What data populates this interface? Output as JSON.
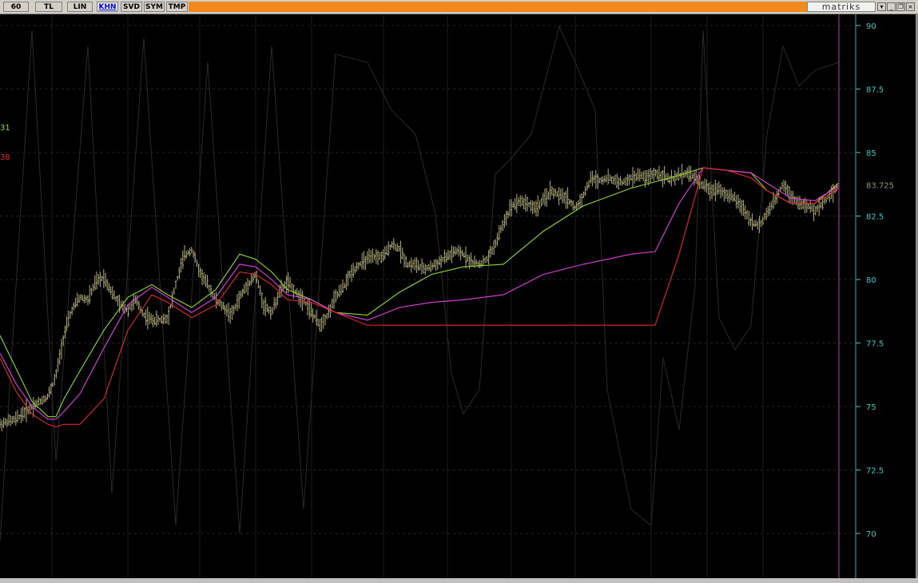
{
  "toolbar": {
    "buttons": [
      "60",
      "TL",
      "LIN",
      "KHN",
      "SVD",
      "SYM",
      "TMP"
    ],
    "active_button": "KHN",
    "brand": "matriks",
    "window_controls": [
      "dropdown-icon",
      "minimize-icon",
      "restore-icon",
      "close-icon"
    ]
  },
  "colors": {
    "background": "#000000",
    "candles": "#b3b07a",
    "ma_green": "#8ed82a",
    "ma_magenta": "#e040e0",
    "ma_red": "#e02828",
    "axis_text": "#3fc7c7",
    "cursor_line": "#c030c0",
    "price_label": "#9a9468"
  },
  "left_labels": [
    {
      "text": "31",
      "color": "#8ed82a"
    },
    {
      "text": "38",
      "color": "#e02828"
    }
  ],
  "chart_data": {
    "type": "line",
    "y_ticks": [
      "90",
      "87.5",
      "85",
      "82.5",
      "80",
      "77.5",
      "75",
      "72.5",
      "70"
    ],
    "ylim": [
      68.3,
      90.3
    ],
    "last_price": "83.725",
    "xlim": [
      0,
      1050
    ],
    "series": [
      {
        "role": "price",
        "x": [
          0,
          20,
          40,
          60,
          70,
          80,
          90,
          100,
          110,
          120,
          130,
          140,
          150,
          160,
          170,
          180,
          190,
          200,
          210,
          220,
          230,
          240,
          250,
          260,
          270,
          280,
          290,
          300,
          310,
          320,
          330,
          340,
          350,
          360,
          370,
          380,
          390,
          400,
          410,
          420,
          430,
          440,
          450,
          460,
          470,
          480,
          490,
          500,
          510,
          520,
          530,
          540,
          550,
          560,
          570,
          580,
          590,
          600,
          610,
          620,
          630,
          640,
          650,
          660,
          670,
          680,
          690,
          700,
          710,
          720,
          730,
          740,
          750,
          760,
          770,
          780,
          790,
          800,
          810,
          820,
          830,
          840,
          850,
          860,
          870,
          880,
          890,
          900,
          910,
          920,
          930,
          940,
          950,
          960,
          970,
          980,
          990,
          1000,
          1010,
          1020,
          1030,
          1040,
          1050
        ],
        "values": [
          74.3,
          74.5,
          75.0,
          75.4,
          76.2,
          77.8,
          78.8,
          79.3,
          79.2,
          79.9,
          80.1,
          79.5,
          79.0,
          78.8,
          79.2,
          78.6,
          78.4,
          78.4,
          78.5,
          79.8,
          80.9,
          81.2,
          80.3,
          79.8,
          79.2,
          78.9,
          78.6,
          79.3,
          79.8,
          80.2,
          79.0,
          78.7,
          79.5,
          79.9,
          79.5,
          79.2,
          78.7,
          78.2,
          78.6,
          79.3,
          79.7,
          80.3,
          80.6,
          80.8,
          80.9,
          80.9,
          81.4,
          81.2,
          80.6,
          80.6,
          80.4,
          80.5,
          80.7,
          80.9,
          81.1,
          81.0,
          80.7,
          80.6,
          80.8,
          81.4,
          82.2,
          82.9,
          83.1,
          83.0,
          82.8,
          83.1,
          83.5,
          83.3,
          83.2,
          82.8,
          83.3,
          84.0,
          83.9,
          84.0,
          83.9,
          83.8,
          84.0,
          84.1,
          84.0,
          84.2,
          84.1,
          83.9,
          84.1,
          84.2,
          84.0,
          83.7,
          83.5,
          83.6,
          83.3,
          83.2,
          82.8,
          82.3,
          82.1,
          82.6,
          83.1,
          83.8,
          83.3,
          83.0,
          82.9,
          82.7,
          83.0,
          83.4,
          83.725
        ]
      },
      {
        "role": "ma_green",
        "x": [
          0,
          20,
          40,
          60,
          70,
          80,
          100,
          130,
          160,
          190,
          210,
          240,
          270,
          300,
          320,
          340,
          360,
          390,
          420,
          460,
          500,
          540,
          580,
          630,
          680,
          730,
          790,
          850,
          880,
          910,
          940,
          960,
          990,
          1020,
          1050
        ],
        "values": [
          77.8,
          76.5,
          75.2,
          74.6,
          74.6,
          75.3,
          76.4,
          78.0,
          79.3,
          79.8,
          79.4,
          78.9,
          79.6,
          81.0,
          80.8,
          80.3,
          79.6,
          79.2,
          78.7,
          78.6,
          79.5,
          80.2,
          80.5,
          80.6,
          81.9,
          82.9,
          83.6,
          84.1,
          84.4,
          84.3,
          84.2,
          83.5,
          83.0,
          83.0,
          83.8
        ]
      },
      {
        "role": "ma_magenta",
        "x": [
          0,
          20,
          40,
          60,
          70,
          80,
          100,
          130,
          160,
          190,
          210,
          240,
          270,
          300,
          320,
          340,
          360,
          390,
          420,
          460,
          500,
          540,
          580,
          630,
          680,
          730,
          790,
          820,
          850,
          880,
          910,
          940,
          960,
          990,
          1020,
          1050
        ],
        "values": [
          77.1,
          75.9,
          75.0,
          74.5,
          74.5,
          74.8,
          75.5,
          77.3,
          79.0,
          79.7,
          79.3,
          78.7,
          79.3,
          80.6,
          80.5,
          80.0,
          79.4,
          79.2,
          78.7,
          78.4,
          78.9,
          79.1,
          79.2,
          79.4,
          80.2,
          80.6,
          81.0,
          81.1,
          83.0,
          84.4,
          84.3,
          84.2,
          83.8,
          83.2,
          83.1,
          83.7
        ]
      },
      {
        "role": "ma_red",
        "x": [
          0,
          20,
          40,
          60,
          70,
          80,
          100,
          130,
          160,
          190,
          210,
          240,
          270,
          300,
          320,
          340,
          360,
          390,
          420,
          460,
          500,
          540,
          580,
          630,
          680,
          730,
          790,
          820,
          850,
          880,
          910,
          940,
          960,
          990,
          1020,
          1050
        ],
        "values": [
          76.9,
          75.6,
          74.7,
          74.3,
          74.2,
          74.3,
          74.3,
          75.3,
          78.0,
          79.4,
          79.1,
          78.5,
          79.0,
          80.3,
          80.2,
          79.8,
          79.2,
          79.1,
          78.7,
          78.2,
          78.2,
          78.2,
          78.2,
          78.2,
          78.2,
          78.2,
          78.2,
          78.2,
          81.0,
          84.4,
          84.3,
          84.0,
          83.5,
          83.0,
          83.0,
          83.6
        ]
      }
    ]
  }
}
